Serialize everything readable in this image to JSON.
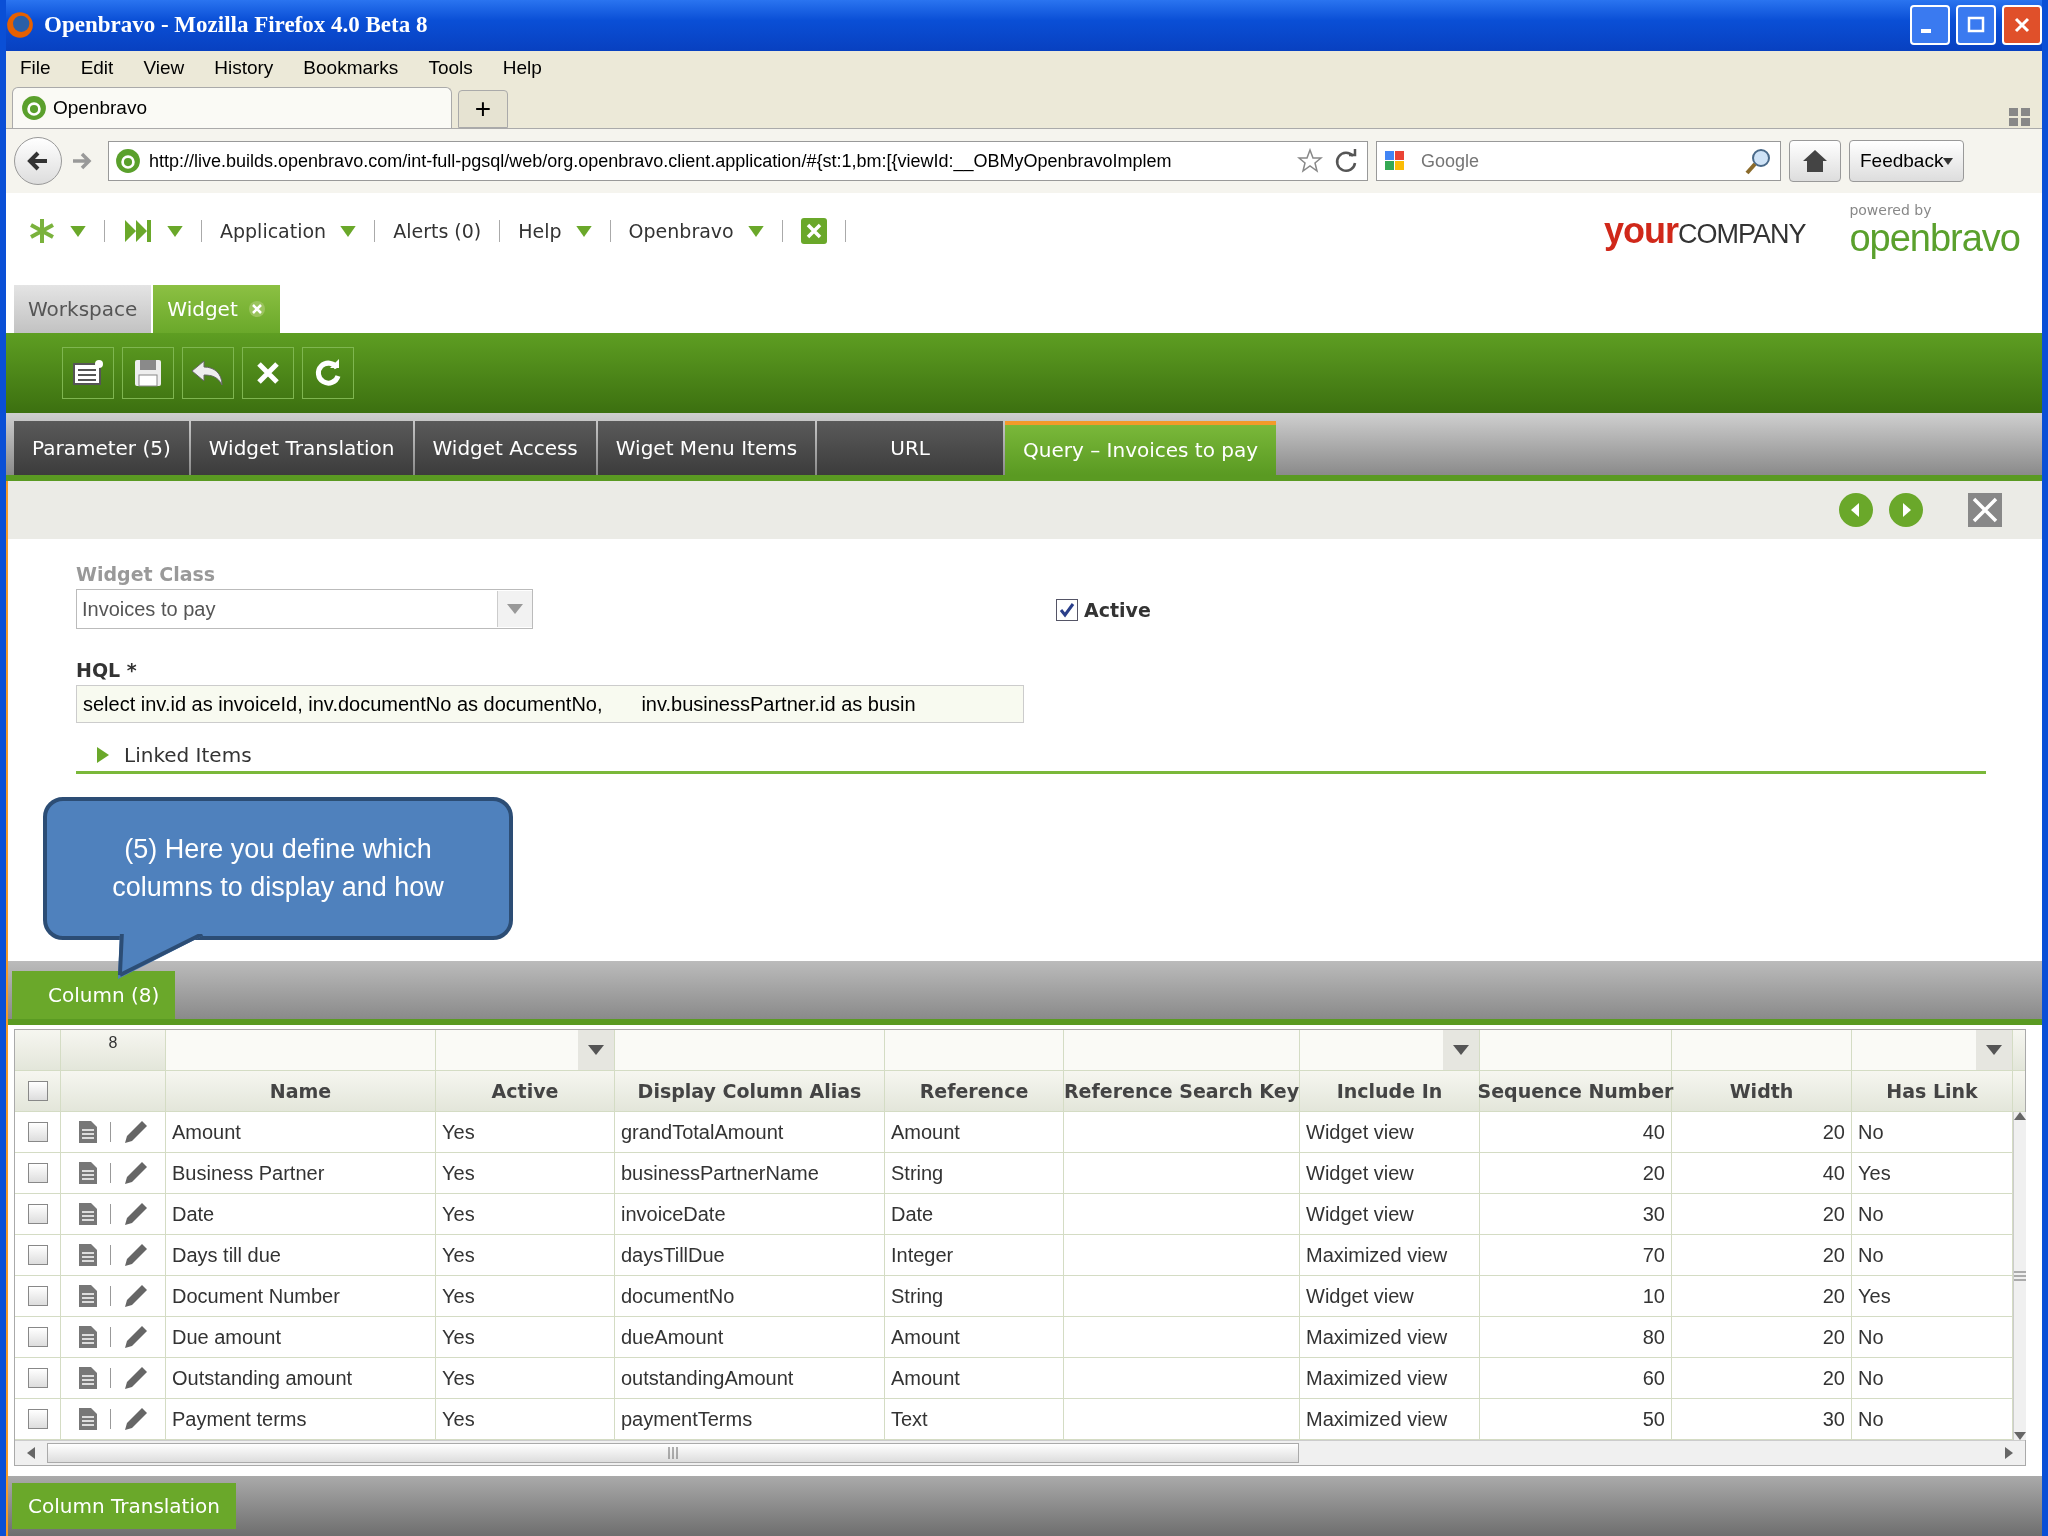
{
  "window": {
    "title": "Openbravo - Mozilla Firefox 4.0 Beta 8"
  },
  "menu": [
    "File",
    "Edit",
    "View",
    "History",
    "Bookmarks",
    "Tools",
    "Help"
  ],
  "browser_tab": {
    "title": "Openbravo",
    "new_tab": "+"
  },
  "address_bar": {
    "url": "http://live.builds.openbravo.com/int-full-pgsql/web/org.openbravo.client.application/#{st:1,bm:[{viewId:__OBMyOpenbravoImplem"
  },
  "search": {
    "placeholder": "Google"
  },
  "feedback_button": "Feedback",
  "app_nav": [
    {
      "label": "Application",
      "dropdown": true
    },
    {
      "label": "Alerts (0)",
      "dropdown": false
    },
    {
      "label": "Help",
      "dropdown": true
    },
    {
      "label": "Openbravo",
      "dropdown": true
    }
  ],
  "company_logo": [
    "your",
    "COMPANY"
  ],
  "powered_by": {
    "caption": "powered by",
    "brand": "openbravo"
  },
  "view_tabs": [
    {
      "label": "Workspace",
      "selected": false,
      "closable": false
    },
    {
      "label": "Widget",
      "selected": true,
      "closable": true
    }
  ],
  "subtabs": [
    {
      "label": "Parameter (5)",
      "selected": false
    },
    {
      "label": "Widget Translation",
      "selected": false
    },
    {
      "label": "Widget Access",
      "selected": false
    },
    {
      "label": "Wiget Menu Items",
      "selected": false
    },
    {
      "label": "URL",
      "selected": false
    },
    {
      "label": "Query – Invoices to pay",
      "selected": true
    }
  ],
  "form": {
    "widget_class": {
      "label": "Widget Class",
      "value": "Invoices to pay"
    },
    "active": {
      "label": "Active",
      "checked": true
    },
    "hql": {
      "label": "HQL *",
      "value": "select inv.id as invoiceId, inv.documentNo as documentNo,       inv.businessPartner.id as busin"
    },
    "linked_items": {
      "label": "Linked Items",
      "expanded": false
    }
  },
  "callout": "(5) Here you define which columns to display and how",
  "section_tab": "Column (8)",
  "grid": {
    "record_count": "8",
    "all_checked": false,
    "columns": [
      {
        "label": "Name",
        "kind": "text"
      },
      {
        "label": "Active",
        "kind": "choice"
      },
      {
        "label": "Display Column Alias",
        "kind": "text"
      },
      {
        "label": "Reference",
        "kind": "text"
      },
      {
        "label": "Reference Search Key",
        "kind": "text"
      },
      {
        "label": "Include In",
        "kind": "choice"
      },
      {
        "label": "Sequence Number",
        "kind": "number"
      },
      {
        "label": "Width",
        "kind": "number"
      },
      {
        "label": "Has Link",
        "kind": "choice"
      }
    ],
    "rows": [
      {
        "checked": false,
        "cells": [
          "Amount",
          "Yes",
          "grandTotalAmount",
          "Amount",
          "",
          "Widget view",
          "40",
          "20",
          "No"
        ]
      },
      {
        "checked": false,
        "cells": [
          "Business Partner",
          "Yes",
          "businessPartnerName",
          "String",
          "",
          "Widget view",
          "20",
          "40",
          "Yes"
        ]
      },
      {
        "checked": false,
        "cells": [
          "Date",
          "Yes",
          "invoiceDate",
          "Date",
          "",
          "Widget view",
          "30",
          "20",
          "No"
        ]
      },
      {
        "checked": false,
        "cells": [
          "Days till due",
          "Yes",
          "daysTillDue",
          "Integer",
          "",
          "Maximized view",
          "70",
          "20",
          "No"
        ]
      },
      {
        "checked": false,
        "cells": [
          "Document Number",
          "Yes",
          "documentNo",
          "String",
          "",
          "Widget view",
          "10",
          "20",
          "Yes"
        ]
      },
      {
        "checked": false,
        "cells": [
          "Due amount",
          "Yes",
          "dueAmount",
          "Amount",
          "",
          "Maximized view",
          "80",
          "20",
          "No"
        ]
      },
      {
        "checked": false,
        "cells": [
          "Outstanding amount",
          "Yes",
          "outstandingAmount",
          "Amount",
          "",
          "Maximized view",
          "60",
          "20",
          "No"
        ]
      },
      {
        "checked": false,
        "cells": [
          "Payment terms",
          "Yes",
          "paymentTerms",
          "Text",
          "",
          "Maximized view",
          "50",
          "30",
          "No"
        ]
      }
    ]
  },
  "bottom_tab": "Column Translation"
}
